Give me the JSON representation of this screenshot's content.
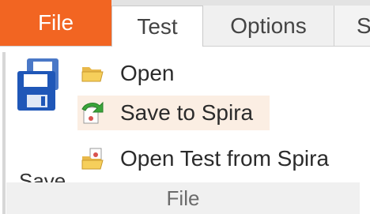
{
  "tabs": {
    "file": "File",
    "active": "Test",
    "options": "Options",
    "partial": "S"
  },
  "ribbon": {
    "save_big_label": "Save",
    "items": {
      "open": "Open",
      "save_to_spira": "Save to Spira",
      "open_from_spira": "Open Test from Spira"
    },
    "group_label": "File"
  },
  "colors": {
    "file_tab": "#f26522",
    "hover_item": "#fbeee3",
    "tab_bar": "#e3e3e3",
    "group_footer": "#f0f0f0"
  },
  "icons": {
    "save": "floppy-disk-icon",
    "open": "folder-open-icon",
    "save_to_spira": "spira-upload-icon",
    "open_from_spira": "spira-folder-icon"
  }
}
